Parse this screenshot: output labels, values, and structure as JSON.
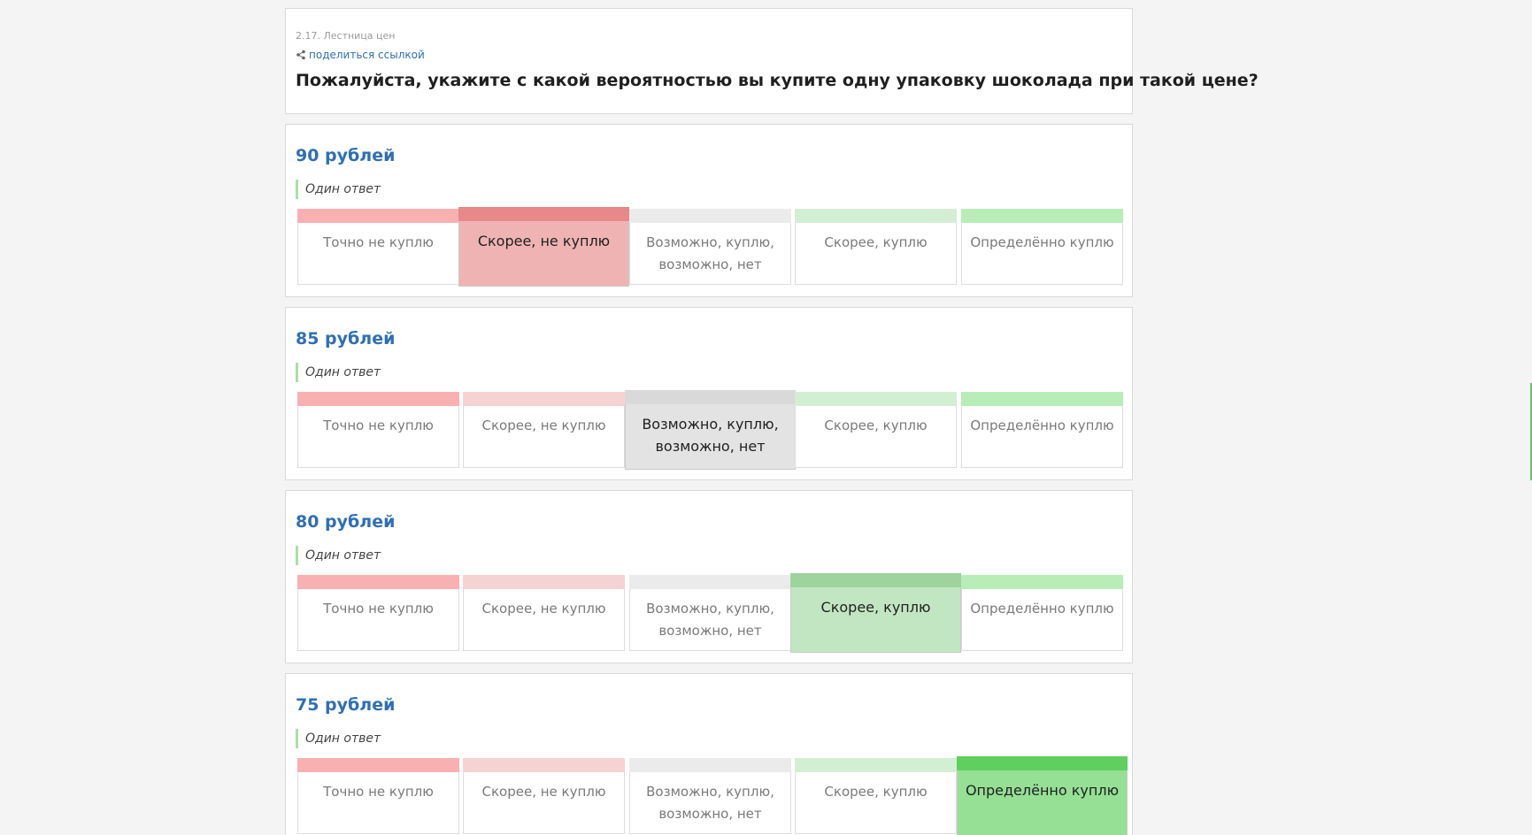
{
  "header": {
    "section_label": "2.17. Лестница цен",
    "share_link": "поделиться ссылкой",
    "question": "Пожалуйста, укажите с какой вероятностью вы купите одну упаковку шоколада при такой цене?"
  },
  "options": [
    "Точно не куплю",
    "Скорее, не куплю",
    "Возможно, куплю,\nвозможно, нет",
    "Скорее, куплю",
    "Определённо куплю"
  ],
  "option_colors": {
    "bar": [
      "#f9b0b0",
      "#f6d3d3",
      "#ebebeb",
      "#d3efd3",
      "#b8edb8"
    ],
    "selected_bar": [
      "#e88888",
      "#e88888",
      "#d9d9d9",
      "#9ed39e",
      "#5fcf5f"
    ],
    "selected_fill": [
      "#f0b3b3",
      "#f0b3b3",
      "#e3e3e3",
      "#c2e6c2",
      "#95e095"
    ]
  },
  "prices": [
    {
      "title": "90 рублей",
      "answer_type": "Один ответ",
      "selected_index": 1
    },
    {
      "title": "85 рублей",
      "answer_type": "Один ответ",
      "selected_index": 2
    },
    {
      "title": "80 рублей",
      "answer_type": "Один ответ",
      "selected_index": 3
    },
    {
      "title": "75 рублей",
      "answer_type": "Один ответ",
      "selected_index": 4
    }
  ]
}
